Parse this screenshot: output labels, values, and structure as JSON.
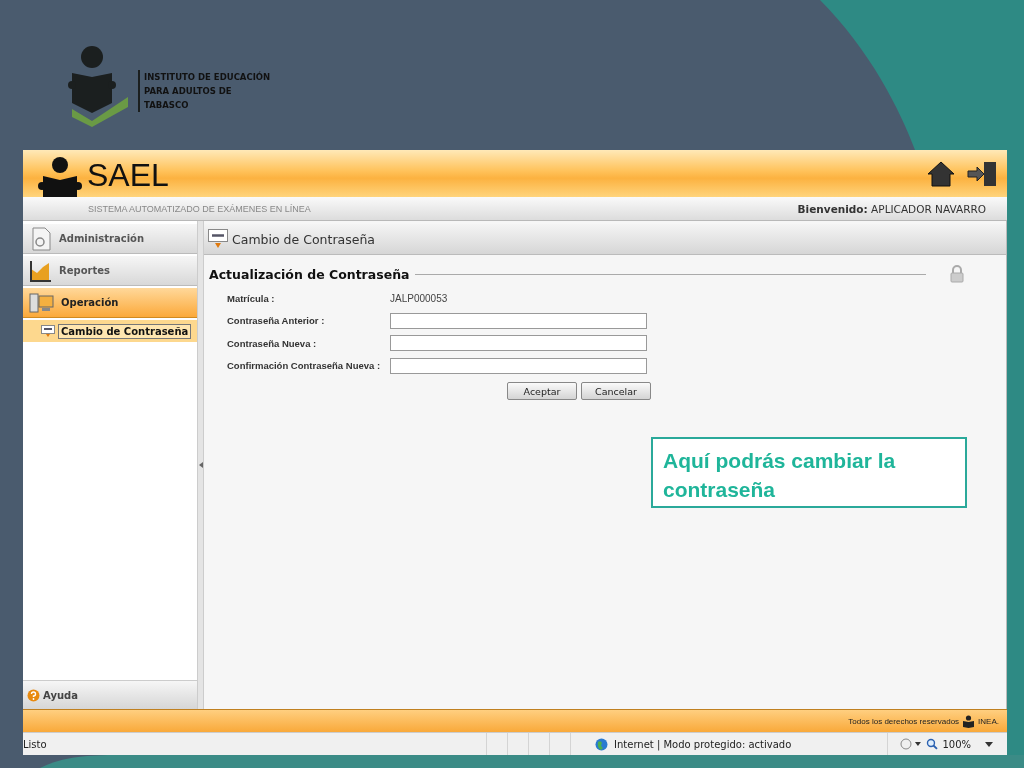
{
  "org_logo": {
    "lines": [
      "INSTITUTO DE EDUCACIÓN",
      "PARA ADULTOS DE",
      "TABASCO"
    ]
  },
  "app": {
    "name": "SAEL",
    "subtitle": "SISTEMA AUTOMATIZADO DE EXÁMENES EN LÍNEA",
    "welcome_label": "Bienvenido:",
    "user": "APLICADOR NAVARRO"
  },
  "sidebar": {
    "sections": [
      {
        "label": "Administración",
        "kind": "admin",
        "selected": false
      },
      {
        "label": "Reportes",
        "kind": "reports",
        "selected": false
      },
      {
        "label": "Operación",
        "kind": "operation",
        "selected": true
      }
    ],
    "submenu": [
      {
        "label": "Cambio de Contraseña",
        "selected": true
      }
    ],
    "help": "Ayuda"
  },
  "page": {
    "title": "Cambio de Contraseña",
    "section": "Actualización de Contraseña",
    "fields": [
      {
        "label": "Matrícula :",
        "kind": "text",
        "value": "JALP000053"
      },
      {
        "label": "Contraseña Anterior :",
        "kind": "input"
      },
      {
        "label": "Contraseña Nueva :",
        "kind": "input"
      },
      {
        "label": "Confirmación Contraseña Nueva :",
        "kind": "input"
      }
    ],
    "buttons": [
      "Aceptar",
      "Cancelar"
    ]
  },
  "callout": "Aquí podrás cambiar la contraseña",
  "footer": {
    "rights": "Todos los derechos reservados",
    "brand": "INEA."
  },
  "status_bar": {
    "status": "Listo",
    "zone": "Internet | Modo protegido: activado",
    "zoom": "100%"
  }
}
